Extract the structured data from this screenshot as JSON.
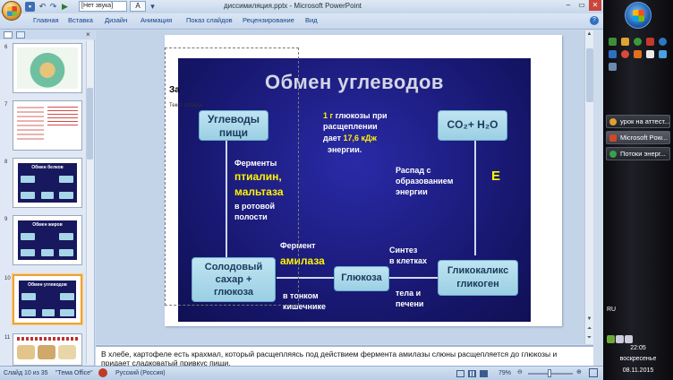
{
  "titlebar": {
    "voice_combo": "[Нет звука]",
    "font_label": "A",
    "window_title": "диссимиляция.pptx - Microsoft PowerPoint",
    "minimize": "–",
    "restore": "▭",
    "close": "✕"
  },
  "ribbon": {
    "tabs": [
      "Главная",
      "Вставка",
      "Дизайн",
      "Анимация",
      "Показ слайдов",
      "Рецензирование",
      "Вид"
    ],
    "help": "?"
  },
  "left_pane": {
    "close": "×",
    "thumbnails": [
      {
        "num": "6"
      },
      {
        "num": "7"
      },
      {
        "num": "8",
        "title": "Обмен белков"
      },
      {
        "num": "9",
        "title": "Обмен жиров"
      },
      {
        "num": "10",
        "title": "Обмен углеводов"
      },
      {
        "num": "11"
      }
    ]
  },
  "slide": {
    "overlay_heading": "За",
    "overlay_text": "Текст слайда",
    "image": {
      "title": "Обмен углеводов",
      "box_food": "Углеводы\nпищи",
      "fact_line1_prefix": "1 г",
      "fact_line1_rest": " глюкозы при",
      "fact_line2": "расщеплении",
      "fact_line3_prefix": "дает ",
      "fact_line3_value": "17,6 кДж",
      "fact_line4": "энергии.",
      "box_co2": "CO₂+ H₂O",
      "enzymes_label": "Ферменты",
      "enzyme_ptialin": "птиалин,",
      "enzyme_maltase": "мальтаза",
      "in_mouth_1": "в ротовой",
      "in_mouth_2": "полости",
      "decay_1": "Распад с",
      "decay_2": "образованием",
      "decay_3": "энергии",
      "energy": "E",
      "enzyme_label": "Фермент",
      "amylase": "амилаза",
      "synthesis_1": "Синтез",
      "synthesis_2": "в клетках",
      "box_malt": "Солодовый\nсахар +\nглюкоза",
      "box_glucose": "Глюкоза",
      "box_glycogen": "Гликокаликс\nгликоген",
      "intestine_1": "в тонком",
      "intestine_2": "кишечнике",
      "tissue_1": "тела и",
      "tissue_2": "печени"
    }
  },
  "notes": {
    "text": "В хлебе, картофеле есть крахмал, который расщепляясь под действием фермента амилазы слюны расщепляется до глюкозы и придает сладковатый привкус пищи."
  },
  "statusbar": {
    "slide_info": "Слайд 10 из 35",
    "theme": "\"Тема Office\"",
    "language": "Русский (Россия)",
    "zoom": "79%"
  },
  "taskbar": {
    "tasks": [
      "урок на аттест...",
      "Microsoft Pow...",
      "Потоки энерг..."
    ],
    "lang": "RU",
    "time": "22:05",
    "day": "воскресенье",
    "date": "08.11.2015"
  },
  "colors": {
    "slide_background": "#16166b",
    "box_fill": "#a9d9ec",
    "highlight_text": "#fff200"
  }
}
